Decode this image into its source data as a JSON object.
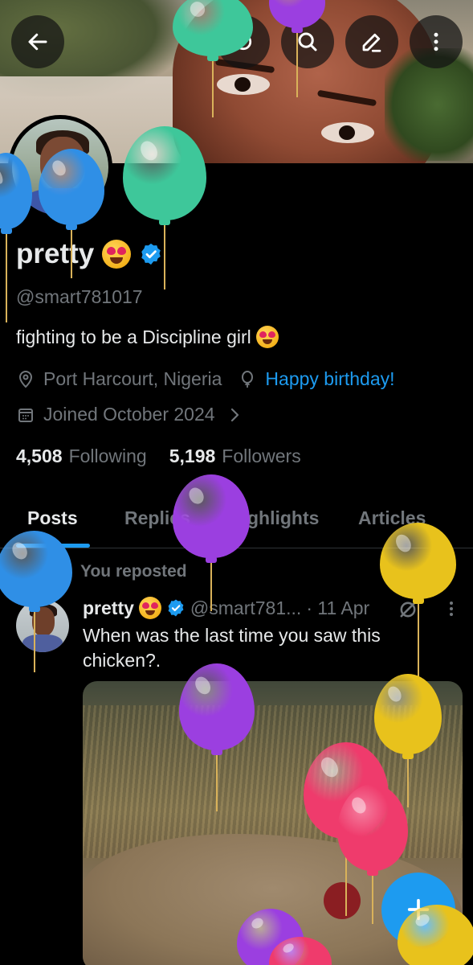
{
  "profile": {
    "name": "pretty",
    "handle": "@smart781017",
    "bio": "fighting to be a Discipline girl",
    "location": "Port Harcourt, Nigeria",
    "birthday": "Happy birthday!",
    "joined": "Joined October 2024",
    "following_count": "4,508",
    "following_label": "Following",
    "followers_count": "5,198",
    "followers_label": "Followers"
  },
  "tabs": [
    {
      "label": "Posts",
      "active": true
    },
    {
      "label": "Replies",
      "active": false
    },
    {
      "label": "Highlights",
      "active": false
    },
    {
      "label": "Articles",
      "active": false
    }
  ],
  "header_buttons": [
    "back-arrow-icon",
    "grok-icon",
    "search-icon",
    "edit-icon",
    "more-vertical-icon"
  ],
  "post": {
    "repost_label": "You reposted",
    "author_name": "pretty",
    "author_handle": "@smart781...",
    "date": "· 11 Apr",
    "text": "When was the last time you saw this chicken?."
  },
  "colors": {
    "accent": "#1d9bf0",
    "background": "#000000",
    "text_primary": "#e7e9ea",
    "text_secondary": "#71767b"
  },
  "decorations": {
    "balloon_colors": [
      "#3ec79a",
      "#9b3fe0",
      "#2f8fe6",
      "#e8c21c",
      "#ef3b6c"
    ]
  }
}
